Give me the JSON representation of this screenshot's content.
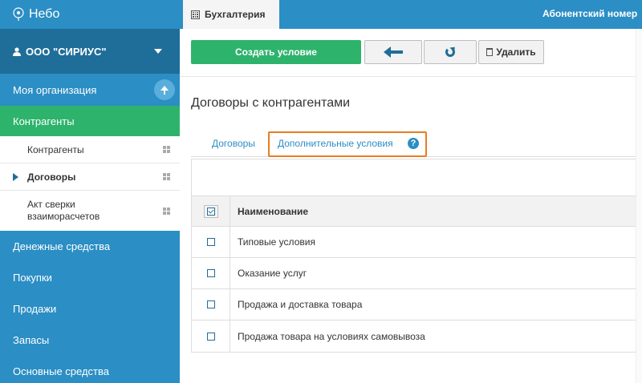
{
  "app": {
    "logo_text": "Небо"
  },
  "topbar": {
    "active_tab": "Бухгалтерия",
    "subscriber": "Абонентский номер"
  },
  "sidebar": {
    "org_name": "ООО \"СИРИУС\"",
    "items": [
      {
        "label": "Моя организация"
      },
      {
        "label": "Контрагенты"
      }
    ],
    "subitems": [
      {
        "label": "Контрагенты"
      },
      {
        "label": "Договоры"
      },
      {
        "label": "Акт сверки взаиморасчетов"
      }
    ],
    "bottom_items": [
      {
        "label": "Денежные средства"
      },
      {
        "label": "Покупки"
      },
      {
        "label": "Продажи"
      },
      {
        "label": "Запасы"
      },
      {
        "label": "Основные средства"
      }
    ]
  },
  "toolbar": {
    "create_label": "Создать условие",
    "delete_label": "Удалить"
  },
  "page": {
    "title": "Договоры с контрагентами"
  },
  "tabs": [
    {
      "label": "Договоры"
    },
    {
      "label": "Дополнительные условия"
    }
  ],
  "table": {
    "column": "Наименование",
    "rows": [
      {
        "name": "Типовые условия"
      },
      {
        "name": "Оказание услуг"
      },
      {
        "name": "Продажа и доставка товара"
      },
      {
        "name": "Продажа товара на условиях самовывоза"
      }
    ]
  },
  "colors": {
    "sidebar": "#2b8ec4",
    "org_box": "#1f6e99",
    "active_green": "#2eb36c",
    "highlight_orange": "#e67e22"
  },
  "icons": {
    "logo": "logo-icon",
    "user": "user-icon",
    "caret": "chevron-down-icon",
    "collapse": "arrow-up-icon",
    "grid": "grid-icon",
    "calc": "calculator-icon",
    "back": "arrow-left-icon",
    "refresh": "refresh-icon",
    "trash": "trash-icon",
    "help": "help-icon"
  }
}
